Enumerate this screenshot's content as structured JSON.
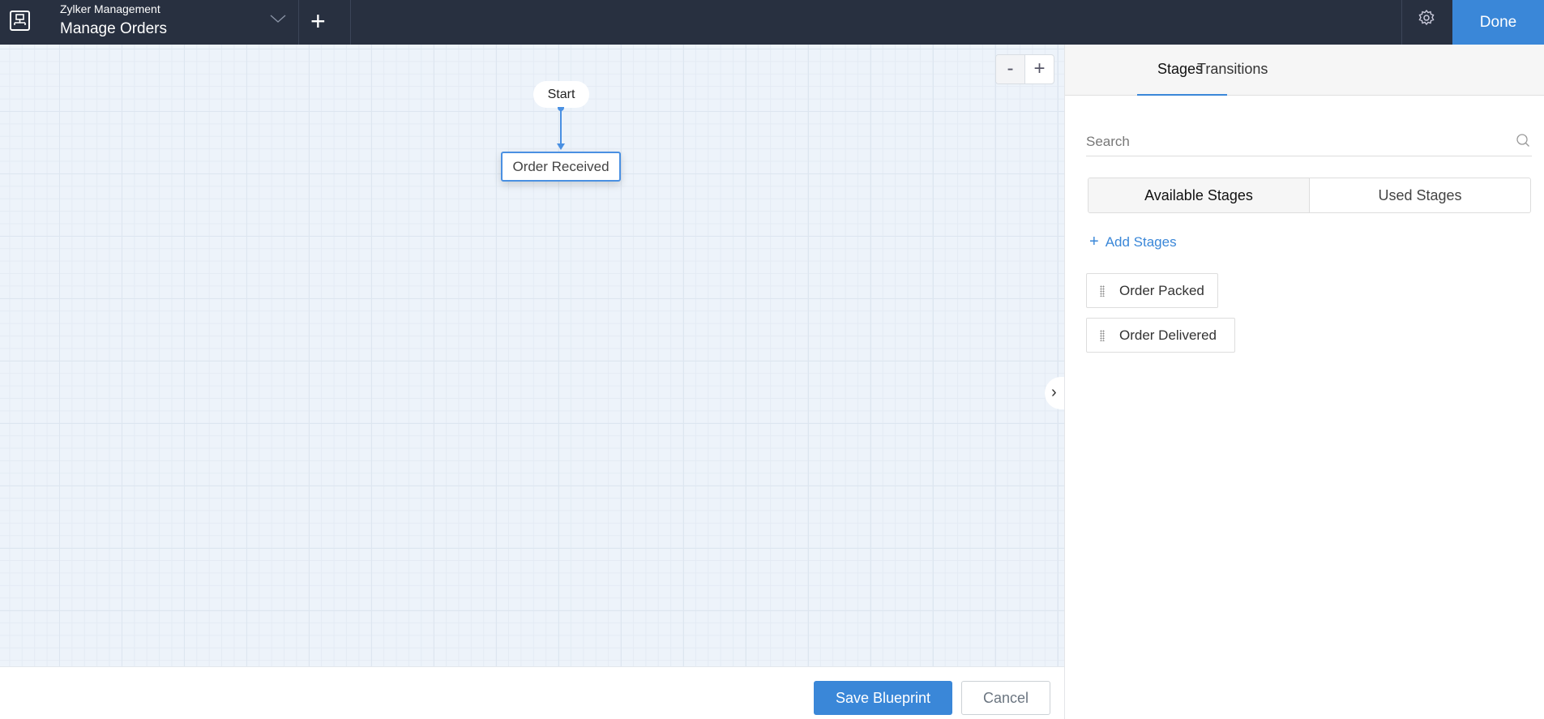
{
  "header": {
    "org": "Zylker Management",
    "title": "Manage Orders",
    "done_label": "Done"
  },
  "canvas": {
    "zoom_out": "-",
    "zoom_in": "+",
    "start_node": "Start",
    "stage_nodes": [
      "Order Received"
    ]
  },
  "footer": {
    "save_label": "Save Blueprint",
    "cancel_label": "Cancel"
  },
  "panel": {
    "tabs": [
      "Stages",
      "Transitions"
    ],
    "search_placeholder": "Search",
    "segments": [
      "Available Stages",
      "Used Stages"
    ],
    "add_label": "Add Stages",
    "stages": [
      "Order Packed",
      "Order Delivered"
    ]
  },
  "colors": {
    "header_bg": "#283040",
    "accent": "#3a87d8"
  }
}
